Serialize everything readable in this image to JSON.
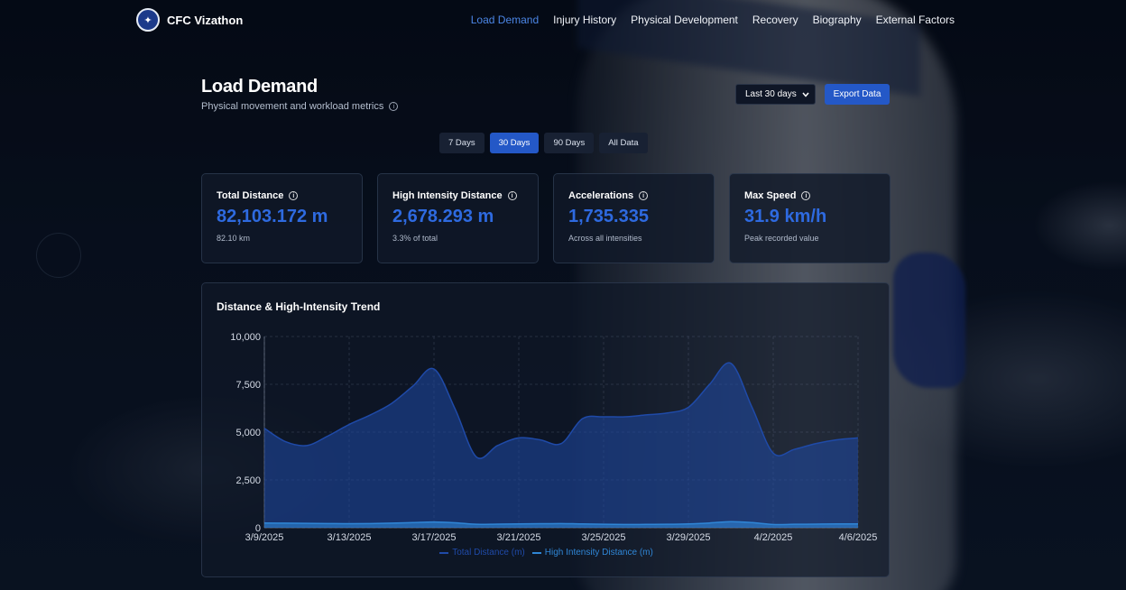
{
  "brand": {
    "name": "CFC Vizathon"
  },
  "nav": {
    "links": [
      {
        "label": "Load Demand",
        "active": true
      },
      {
        "label": "Injury History",
        "active": false
      },
      {
        "label": "Physical Development",
        "active": false
      },
      {
        "label": "Recovery",
        "active": false
      },
      {
        "label": "Biography",
        "active": false
      },
      {
        "label": "External Factors",
        "active": false
      }
    ]
  },
  "header": {
    "title": "Load Demand",
    "subtitle": "Physical movement and workload metrics",
    "period_select": "Last 30 days",
    "export_label": "Export Data"
  },
  "ranges": [
    {
      "label": "7 Days",
      "active": false
    },
    {
      "label": "30 Days",
      "active": true
    },
    {
      "label": "90 Days",
      "active": false
    },
    {
      "label": "All Data",
      "active": false
    }
  ],
  "cards": [
    {
      "label": "Total Distance",
      "value": "82,103.172 m",
      "note": "82.10 km"
    },
    {
      "label": "High Intensity Distance",
      "value": "2,678.293 m",
      "note": "3.3% of total"
    },
    {
      "label": "Accelerations",
      "value": "1,735.335",
      "note": "Across all intensities"
    },
    {
      "label": "Max Speed",
      "value": "31.9 km/h",
      "note": "Peak recorded value"
    }
  ],
  "colors": {
    "accent": "#2458c7",
    "value_blue": "#2e6ae0",
    "total_series": "#1f4aa8",
    "hi_series": "#2f86d6"
  },
  "chart_data": {
    "type": "area",
    "title": "Distance & High-Intensity Trend",
    "x": [
      "3/9/2025",
      "3/10/2025",
      "3/11/2025",
      "3/12/2025",
      "3/13/2025",
      "3/14/2025",
      "3/15/2025",
      "3/16/2025",
      "3/17/2025",
      "3/18/2025",
      "3/19/2025",
      "3/20/2025",
      "3/21/2025",
      "3/22/2025",
      "3/23/2025",
      "3/24/2025",
      "3/25/2025",
      "3/26/2025",
      "3/27/2025",
      "3/28/2025",
      "3/29/2025",
      "3/30/2025",
      "3/31/2025",
      "4/1/2025",
      "4/2/2025",
      "4/3/2025",
      "4/4/2025",
      "4/5/2025",
      "4/6/2025"
    ],
    "x_ticks": [
      "3/9/2025",
      "3/13/2025",
      "3/17/2025",
      "3/21/2025",
      "3/25/2025",
      "3/29/2025",
      "4/2/2025",
      "4/6/2025"
    ],
    "y_ticks": [
      "0",
      "2,500",
      "5,000",
      "7,500",
      "10,000"
    ],
    "ylim": [
      0,
      10000
    ],
    "grid": true,
    "legend_position": "bottom",
    "series": [
      {
        "name": "Total Distance (m)",
        "color": "#1f4aa8",
        "values": [
          5200,
          4500,
          4300,
          4800,
          5400,
          5900,
          6500,
          7400,
          8300,
          6200,
          3700,
          4300,
          4700,
          4600,
          4400,
          5700,
          5800,
          5800,
          5900,
          6000,
          6300,
          7500,
          8600,
          6300,
          3900,
          4100,
          4400,
          4600,
          4700
        ]
      },
      {
        "name": "High Intensity Distance (m)",
        "color": "#2f86d6",
        "values": [
          250,
          240,
          230,
          220,
          210,
          220,
          240,
          270,
          300,
          260,
          180,
          190,
          200,
          210,
          220,
          200,
          180,
          170,
          175,
          180,
          200,
          250,
          320,
          270,
          170,
          180,
          190,
          200,
          200
        ]
      }
    ]
  }
}
